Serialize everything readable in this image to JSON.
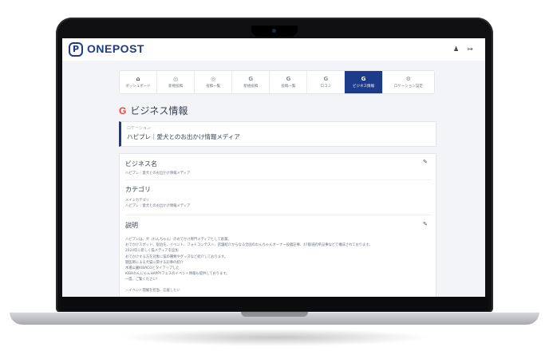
{
  "app": {
    "logo_letter": "P",
    "name": "ONEPOST"
  },
  "header": {
    "user_icon": "user-icon",
    "logout_icon": "logout-icon"
  },
  "tabs": [
    {
      "icon": "home-icon",
      "glyph": "⌂",
      "label": "ダッシュボード",
      "active": false
    },
    {
      "icon": "instagram-icon",
      "glyph": "◎",
      "label": "新規投稿",
      "active": false
    },
    {
      "icon": "instagram-icon",
      "glyph": "◎",
      "label": "投稿一覧",
      "active": false
    },
    {
      "icon": "google-icon",
      "glyph": "G",
      "label": "新規投稿",
      "active": false
    },
    {
      "icon": "google-icon",
      "glyph": "G",
      "label": "投稿一覧",
      "active": false
    },
    {
      "icon": "google-icon",
      "glyph": "G",
      "label": "口コミ",
      "active": false
    },
    {
      "icon": "google-icon",
      "glyph": "G",
      "label": "ビジネス情報",
      "active": true
    },
    {
      "icon": "gear-icon",
      "glyph": "⚙",
      "label": "ロケーション設定",
      "active": false
    }
  ],
  "page": {
    "title": "ビジネス情報"
  },
  "location": {
    "label": "ロケーション",
    "value": "ハピプレ｜愛犬とのお出かけ情報メディア"
  },
  "business": {
    "name_title": "ビジネス名",
    "name_value": "ハピプレ｜愛犬とのお出かけ情報メディア",
    "category_title": "カテゴリ",
    "category_label": "メインカテゴリ",
    "category_value": "ハピプレ｜愛犬とのお出かけ情報メディア",
    "description_title": "説明",
    "description_lines": [
      "ハピプレは、犬（わんちゃん）のおでかけ専門メディアとして創業。",
      "おでかけスポット、宿泊先、イベント、フォトコンテスト、店舗紹介からなる全国のわんちゃんオーナー投稿記事、47都道府県記事などで構成されております。",
      "2024年に新しく猫メディアを追加",
      "おでかけする方を対象に猫の種類やグッズなど紹介しております。",
      "獣医師による犬猫に関する記事の紹介",
      "木場公園KIBACOとタイアップした",
      "KIBAわんにゃんHAPPYフェスのイベント情報も提供しております。",
      "一度、ご覧ください！",
      "・イベント開催を担当、応援したい"
    ]
  },
  "colors": {
    "brand": "#1e3a8a",
    "google_red": "#ea4335"
  }
}
